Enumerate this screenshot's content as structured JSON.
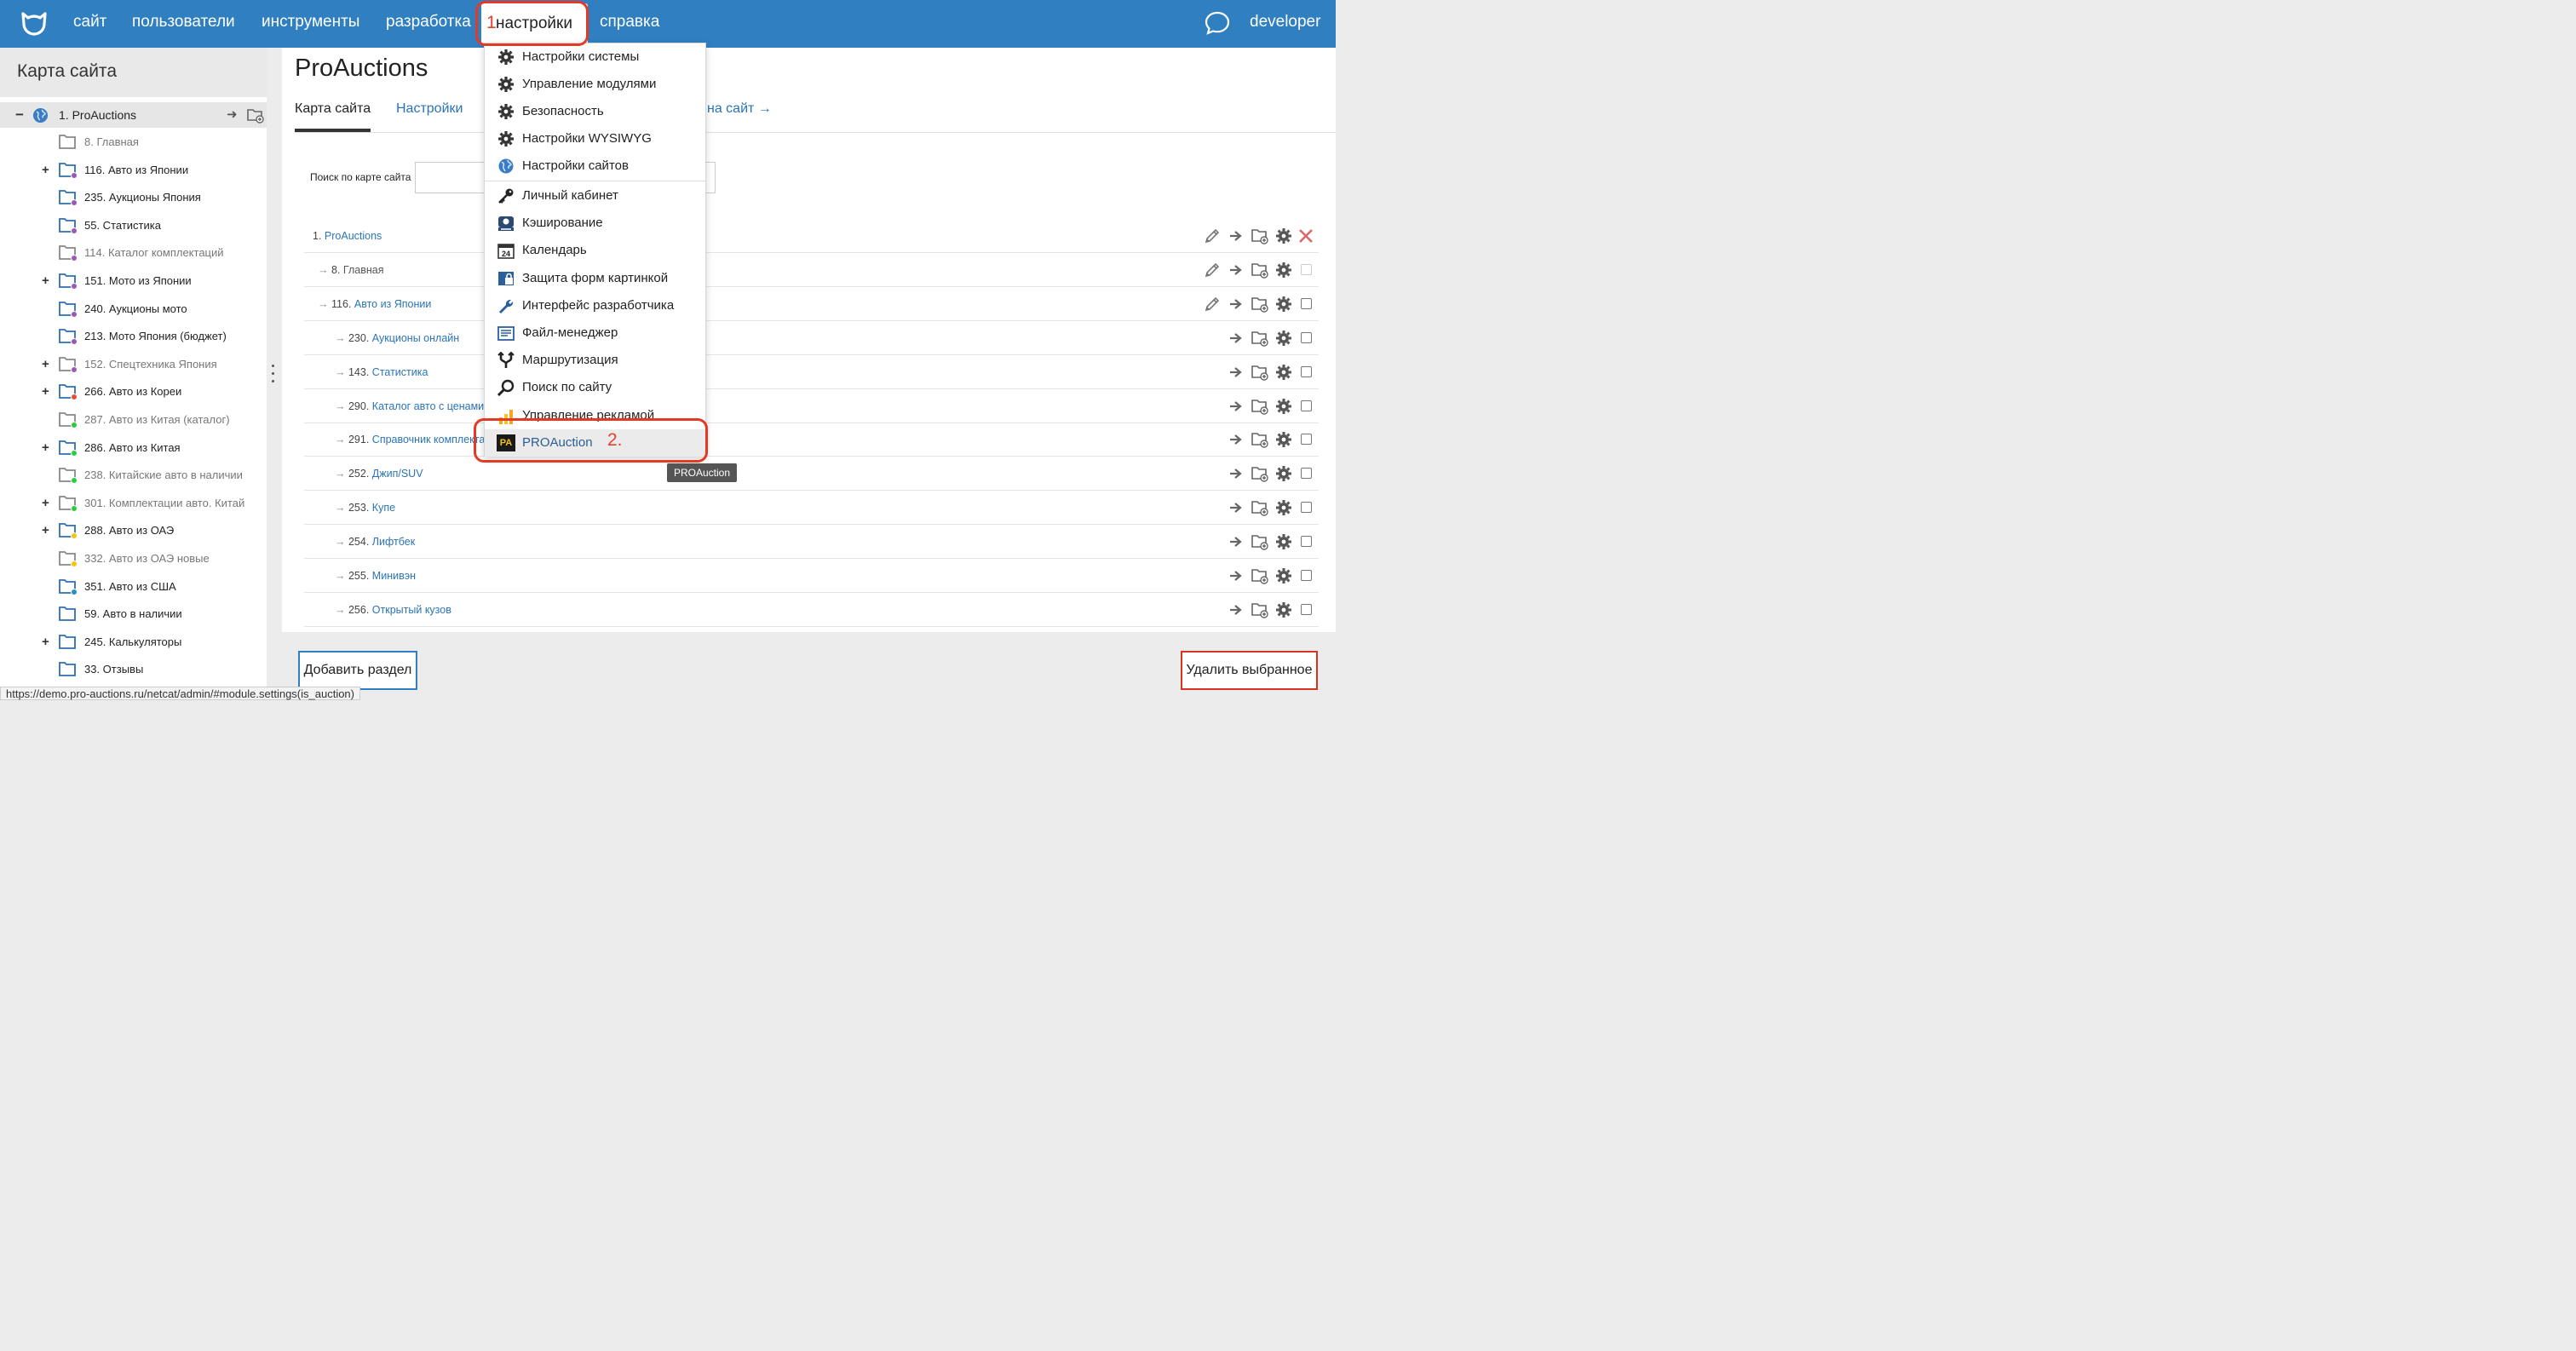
{
  "nav": {
    "items": [
      "сайт",
      "пользователи",
      "инструменты",
      "разработка",
      "настройки",
      "справка"
    ],
    "active_index": "1",
    "user": "developer"
  },
  "sidebar": {
    "title": "Карта сайта",
    "root": "1. ProAuctions",
    "items": [
      {
        "label": "8. Главная",
        "state": "dim",
        "expand": "",
        "dot": ""
      },
      {
        "label": "116. Авто из Японии",
        "state": "norm",
        "expand": "+",
        "dot": "#9b59b6"
      },
      {
        "label": "235. Аукционы Япония",
        "state": "norm",
        "expand": "",
        "dot": "#9b59b6"
      },
      {
        "label": "55. Статистика",
        "state": "norm",
        "expand": "",
        "dot": "#9b59b6"
      },
      {
        "label": "114. Каталог комплектаций",
        "state": "dim",
        "expand": "",
        "dot": "#9b59b6"
      },
      {
        "label": "151. Мото из Японии",
        "state": "norm",
        "expand": "+",
        "dot": "#9b59b6"
      },
      {
        "label": "240. Аукционы мото",
        "state": "norm",
        "expand": "",
        "dot": "#9b59b6"
      },
      {
        "label": "213. Мото Япония (бюджет)",
        "state": "norm",
        "expand": "",
        "dot": "#9b59b6"
      },
      {
        "label": "152. Спецтехника Япония",
        "state": "dim",
        "expand": "+",
        "dot": "#9b59b6"
      },
      {
        "label": "266. Авто из Кореи",
        "state": "norm",
        "expand": "+",
        "dot": "#e74c3c"
      },
      {
        "label": "287. Авто из Китая (каталог)",
        "state": "dim",
        "expand": "",
        "dot": "#2ecc40"
      },
      {
        "label": "286. Авто из Китая",
        "state": "norm",
        "expand": "+",
        "dot": "#2ecc40"
      },
      {
        "label": "238. Китайские авто в наличии",
        "state": "dim",
        "expand": "",
        "dot": "#2ecc40"
      },
      {
        "label": "301. Комплектации авто. Китай",
        "state": "dim",
        "expand": "+",
        "dot": "#2ecc40"
      },
      {
        "label": "288. Авто из ОАЭ",
        "state": "norm",
        "expand": "+",
        "dot": "#f1c40f"
      },
      {
        "label": "332. Авто из ОАЭ новые",
        "state": "dim",
        "expand": "",
        "dot": "#f1c40f"
      },
      {
        "label": "351. Авто из США",
        "state": "norm",
        "expand": "",
        "dot": "#2a8fc4"
      },
      {
        "label": "59. Авто в наличии",
        "state": "norm",
        "expand": "",
        "dot": ""
      },
      {
        "label": "245. Калькуляторы",
        "state": "norm",
        "expand": "+",
        "dot": ""
      },
      {
        "label": "33. Отзывы",
        "state": "norm",
        "expand": "",
        "dot": ""
      }
    ]
  },
  "main": {
    "title": "ProAuctions",
    "tabs": [
      "Карта сайта",
      "Настройки",
      "на сайт →"
    ],
    "search_label": "Поиск по карте сайта",
    "search_value": "",
    "rows": [
      {
        "prefix": "1. ",
        "link": "ProAuctions",
        "arrow": "",
        "edit": "true",
        "delete": "true",
        "checkbox": "none",
        "dim": "false"
      },
      {
        "prefix": "8. ",
        "link": "Главная",
        "arrow": "→",
        "edit": "true",
        "delete": "false",
        "checkbox": "disabled",
        "dim": "true"
      },
      {
        "prefix": "116. ",
        "link": "Авто из Японии",
        "arrow": "→",
        "edit": "true",
        "delete": "false",
        "checkbox": "enabled",
        "dim": "false"
      },
      {
        "prefix": "230. ",
        "link": "Аукционы онлайн",
        "arrow": "→",
        "edit": "false",
        "delete": "false",
        "checkbox": "enabled",
        "dim": "false"
      },
      {
        "prefix": "143. ",
        "link": "Статистика",
        "arrow": "→",
        "edit": "false",
        "delete": "false",
        "checkbox": "enabled",
        "dim": "false"
      },
      {
        "prefix": "290. ",
        "link": "Каталог авто с ценами",
        "arrow": "→",
        "edit": "false",
        "delete": "false",
        "checkbox": "enabled",
        "dim": "false"
      },
      {
        "prefix": "291. ",
        "link": "Справочник комплекта",
        "arrow": "→",
        "edit": "false",
        "delete": "false",
        "checkbox": "enabled",
        "dim": "false"
      },
      {
        "prefix": "252. ",
        "link": "Джип/SUV",
        "arrow": "→",
        "edit": "false",
        "delete": "false",
        "checkbox": "enabled",
        "dim": "false"
      },
      {
        "prefix": "253. ",
        "link": "Купе",
        "arrow": "→",
        "edit": "false",
        "delete": "false",
        "checkbox": "enabled",
        "dim": "false"
      },
      {
        "prefix": "254. ",
        "link": "Лифтбек",
        "arrow": "→",
        "edit": "false",
        "delete": "false",
        "checkbox": "enabled",
        "dim": "false"
      },
      {
        "prefix": "255. ",
        "link": "Минивэн",
        "arrow": "→",
        "edit": "false",
        "delete": "false",
        "checkbox": "enabled",
        "dim": "false"
      },
      {
        "prefix": "256. ",
        "link": "Открытый кузов",
        "arrow": "→",
        "edit": "false",
        "delete": "false",
        "checkbox": "enabled",
        "dim": "false"
      }
    ]
  },
  "dropdown": {
    "items": [
      {
        "label": "Настройки системы",
        "icon": "gear-icon"
      },
      {
        "label": "Управление модулями",
        "icon": "gear-icon"
      },
      {
        "label": "Безопасность",
        "icon": "gear-icon"
      },
      {
        "label": "Настройки WYSIWYG",
        "icon": "gear-icon"
      },
      {
        "label": "Настройки сайтов",
        "icon": "globe-icon"
      },
      {
        "label": "Личный кабинет",
        "icon": "key-icon"
      },
      {
        "label": "Кэширование",
        "icon": "cache-icon"
      },
      {
        "label": "Календарь",
        "icon": "calendar-icon"
      },
      {
        "label": "Защита форм картинкой",
        "icon": "lock-icon"
      },
      {
        "label": "Интерфейс разработчика",
        "icon": "wrench-icon"
      },
      {
        "label": "Файл-менеджер",
        "icon": "file-manager-icon"
      },
      {
        "label": "Маршрутизация",
        "icon": "routing-icon"
      },
      {
        "label": "Поиск по сайту",
        "icon": "search-icon"
      },
      {
        "label": "Управление рекламой",
        "icon": "ads-chart-icon"
      },
      {
        "label": "PROAuction",
        "icon": "pa-logo-icon"
      }
    ],
    "calendar_day": "24",
    "pa_logo_text": "PA",
    "annotation": "2.",
    "tooltip": "PROAuction"
  },
  "footer": {
    "add_label": "Добавить раздел",
    "delete_label": "Удалить выбранное",
    "status_url": "https://demo.pro-auctions.ru/netcat/admin/#module.settings(is_auction)"
  },
  "colors": {
    "nav_bg": "#2f7fc1",
    "link": "#2a74b5",
    "annotation_red": "#e33a25"
  }
}
